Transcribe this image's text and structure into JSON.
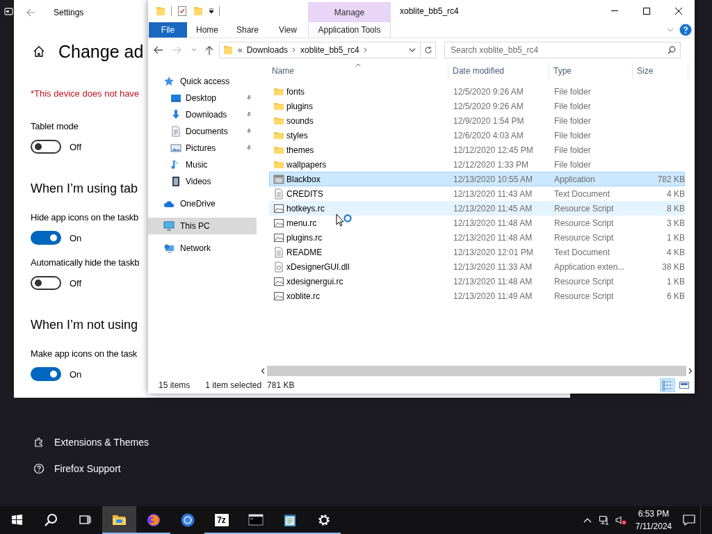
{
  "background_page": {
    "links": [
      {
        "kind": "extensions",
        "label": "Extensions & Themes"
      },
      {
        "kind": "support",
        "label": "Firefox Support"
      }
    ]
  },
  "settings": {
    "title": "Settings",
    "heading": "Change ad",
    "warning": "*This device does not have",
    "items": [
      {
        "kind": "label",
        "text": "Tablet mode"
      },
      {
        "kind": "toggle",
        "on": false,
        "state": "Off"
      },
      {
        "kind": "heading",
        "text": "When I’m using tab"
      },
      {
        "kind": "label",
        "text": "Hide app icons on the taskb"
      },
      {
        "kind": "toggle",
        "on": true,
        "state": "On"
      },
      {
        "kind": "label",
        "text": "Automatically hide the taskb"
      },
      {
        "kind": "toggle",
        "on": false,
        "state": "Off"
      },
      {
        "kind": "heading",
        "text": "When I’m not using"
      },
      {
        "kind": "label",
        "text": "Make app icons on the task"
      },
      {
        "kind": "toggle",
        "on": true,
        "state": "On"
      }
    ]
  },
  "explorer": {
    "title": "xoblite_bb5_rc4",
    "context_group": "Manage",
    "ribbon_tabs": [
      {
        "kind": "file",
        "label": "File"
      },
      {
        "kind": "plain",
        "label": "Home"
      },
      {
        "kind": "plain",
        "label": "Share"
      },
      {
        "kind": "plain",
        "label": "View"
      },
      {
        "kind": "context",
        "label": "Application Tools"
      }
    ],
    "address": {
      "overflow": "«",
      "segments": [
        "Downloads",
        "xoblite_bb5_rc4"
      ]
    },
    "search": {
      "placeholder": "Search xoblite_bb5_rc4"
    },
    "nav": [
      {
        "kind": "quick",
        "label": "Quick access",
        "selected": false,
        "children": [
          {
            "kind": "desktop",
            "label": "Desktop",
            "pinned": true,
            "selected": false
          },
          {
            "kind": "downloads",
            "label": "Downloads",
            "pinned": true,
            "selected": false
          },
          {
            "kind": "documents",
            "label": "Documents",
            "pinned": true,
            "selected": false
          },
          {
            "kind": "pictures",
            "label": "Pictures",
            "pinned": true,
            "selected": false
          },
          {
            "kind": "music",
            "label": "Music",
            "pinned": false,
            "selected": false
          },
          {
            "kind": "videos",
            "label": "Videos",
            "pinned": false,
            "selected": false
          }
        ]
      },
      {
        "kind": "onedrive",
        "label": "OneDrive",
        "selected": false
      },
      {
        "kind": "pc",
        "label": "This PC",
        "selected": true
      },
      {
        "kind": "network",
        "label": "Network",
        "selected": false
      }
    ],
    "columns": [
      {
        "label": "Name",
        "sorted": true
      },
      {
        "label": "Date modified",
        "sorted": false
      },
      {
        "label": "Type",
        "sorted": false
      },
      {
        "label": "Size",
        "sorted": false
      }
    ],
    "rows": [
      {
        "kind": "folder",
        "name": "fonts",
        "date": "12/5/2020 9:26 AM",
        "type": "File folder",
        "selected": false,
        "hovered": false
      },
      {
        "kind": "folder",
        "name": "plugins",
        "date": "12/5/2020 9:26 AM",
        "type": "File folder",
        "selected": false,
        "hovered": false
      },
      {
        "kind": "folder",
        "name": "sounds",
        "date": "12/9/2020 1:54 PM",
        "type": "File folder",
        "selected": false,
        "hovered": false
      },
      {
        "kind": "folder",
        "name": "styles",
        "date": "12/6/2020 4:03 AM",
        "type": "File folder",
        "selected": false,
        "hovered": false
      },
      {
        "kind": "folder",
        "name": "themes",
        "date": "12/12/2020 12:45 PM",
        "type": "File folder",
        "selected": false,
        "hovered": false
      },
      {
        "kind": "folder",
        "name": "wallpapers",
        "date": "12/12/2020 1:33 PM",
        "type": "File folder",
        "selected": false,
        "hovered": false
      },
      {
        "kind": "app",
        "name": "Blackbox",
        "date": "12/13/2020 10:55 AM",
        "type": "Application",
        "size": "782 KB",
        "selected": true,
        "hovered": false
      },
      {
        "kind": "text",
        "name": "CREDITS",
        "date": "12/13/2020 11:43 AM",
        "type": "Text Document",
        "size": "4 KB",
        "selected": false,
        "hovered": false
      },
      {
        "kind": "script",
        "name": "hotkeys.rc",
        "date": "12/13/2020 11:45 AM",
        "type": "Resource Script",
        "size": "8 KB",
        "selected": false,
        "hovered": true
      },
      {
        "kind": "script",
        "name": "menu.rc",
        "date": "12/13/2020 11:48 AM",
        "type": "Resource Script",
        "size": "3 KB",
        "selected": false,
        "hovered": false
      },
      {
        "kind": "script",
        "name": "plugins.rc",
        "date": "12/13/2020 11:48 AM",
        "type": "Resource Script",
        "size": "1 KB",
        "selected": false,
        "hovered": false
      },
      {
        "kind": "text",
        "name": "README",
        "date": "12/13/2020 12:01 PM",
        "type": "Text Document",
        "size": "4 KB",
        "selected": false,
        "hovered": false
      },
      {
        "kind": "dll",
        "name": "xDesignerGUI.dll",
        "date": "12/13/2020 11:33 AM",
        "type": "Application exten...",
        "size": "38 KB",
        "selected": false,
        "hovered": false
      },
      {
        "kind": "script",
        "name": "xdesignergui.rc",
        "date": "12/13/2020 11:48 AM",
        "type": "Resource Script",
        "size": "1 KB",
        "selected": false,
        "hovered": false
      },
      {
        "kind": "script",
        "name": "xoblite.rc",
        "date": "12/13/2020 11:49 AM",
        "type": "Resource Script",
        "size": "6 KB",
        "selected": false,
        "hovered": false
      }
    ],
    "status": {
      "count": "15 items",
      "selection": "1 item selected",
      "size": "781 KB"
    },
    "views": [
      {
        "kind": "details",
        "selected": true
      },
      {
        "kind": "tiles",
        "selected": false
      }
    ]
  },
  "taskbar": {
    "apps": [
      {
        "kind": "start"
      },
      {
        "kind": "search"
      },
      {
        "kind": "taskview"
      },
      {
        "kind": "explorer",
        "running": true,
        "active": true
      },
      {
        "kind": "firefox",
        "running": true,
        "active": false
      },
      {
        "kind": "chrome",
        "running": false,
        "active": false
      },
      {
        "kind": "archiver",
        "label": "7z",
        "running": true,
        "active": false
      },
      {
        "kind": "console",
        "running": true,
        "active": false
      },
      {
        "kind": "notepad",
        "running": true,
        "active": false
      },
      {
        "kind": "settings",
        "running": true,
        "active": false
      }
    ],
    "tray": {
      "volume_muted": true
    },
    "clock": {
      "time": "6:53 PM",
      "date": "7/11/2024"
    }
  }
}
